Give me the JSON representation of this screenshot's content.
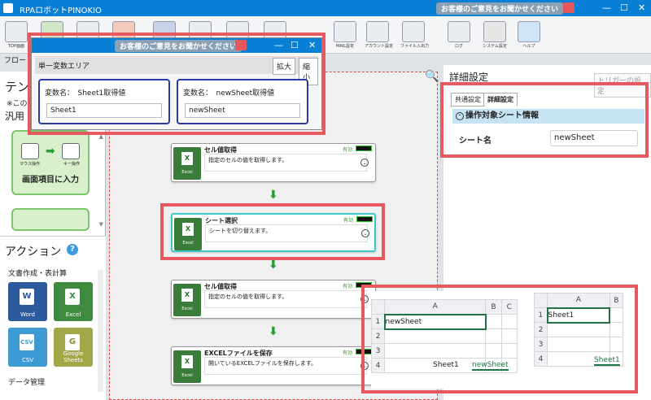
{
  "app": {
    "title": "RPAロボットPINOKIO",
    "feedback": "お客様のご意見をお聞かせください"
  },
  "ribbon": {
    "items": [
      {
        "label": "TOP画面"
      },
      {
        "label": ""
      },
      {
        "label": ""
      },
      {
        "label": ""
      },
      {
        "label": ""
      },
      {
        "label": ""
      },
      {
        "label": ""
      },
      {
        "label": ""
      },
      {
        "label": ""
      },
      {
        "label": ""
      },
      {
        "label": ""
      },
      {
        "label": "MAIL設定"
      },
      {
        "label": "アカウント設定"
      },
      {
        "label": "ファイル入出力"
      },
      {
        "label": "ログ"
      },
      {
        "label": "システム設定"
      },
      {
        "label": "ヘルプ"
      }
    ]
  },
  "flow_label": "フロー",
  "left_panel": {
    "title": "テン",
    "note": "※この",
    "general": "汎用",
    "tile1": {
      "label": "画面項目に入力",
      "mouse": "マウス操作",
      "keyboard": "キー操作"
    }
  },
  "actions": {
    "title": "アクション",
    "help": "?",
    "cat1": "文書作成・表計算",
    "cat2": "データ管理",
    "tiles": [
      {
        "label": "Word",
        "glyph": "W"
      },
      {
        "label": "Excel",
        "glyph": "X"
      },
      {
        "label": "CSV",
        "glyph": "CSV"
      },
      {
        "label": "Google Sheets",
        "glyph": "G"
      }
    ]
  },
  "cards": [
    {
      "title": "セル値取得",
      "desc": "指定のセルの値を取得します。",
      "status": "有効",
      "icon_text": "Excel"
    },
    {
      "title": "シート選択",
      "desc": "シートを切り替えます。",
      "status": "有効",
      "icon_text": "Excel"
    },
    {
      "title": "セル値取得",
      "desc": "指定のセルの値を取得します。",
      "status": "有効",
      "icon_text": "Excel"
    },
    {
      "title": "EXCELファイルを保存",
      "desc": "開いているEXCELファイルを保存します。",
      "status": "有効",
      "icon_text": "Excel"
    }
  ],
  "right_panel": {
    "title": "詳細設定",
    "trigger": "トリガーの設定",
    "tabs": [
      "共通設定",
      "詳細設定"
    ],
    "section": "操作対象シート情報",
    "field_label": "シート名",
    "field_value": "newSheet"
  },
  "popup": {
    "feedback": "お客様のご意見をお聞かせください",
    "header": "単一変数エリア",
    "expand": "拡大",
    "shrink": "縮小",
    "vars": [
      {
        "label": "変数名：　Sheet1取得値",
        "value": "Sheet1"
      },
      {
        "label": "変数名：　newSheet取得値",
        "value": "newSheet"
      }
    ]
  },
  "sheet_left": {
    "cols": [
      "A",
      "B",
      "C"
    ],
    "rows": [
      "1",
      "2",
      "3",
      "4"
    ],
    "cell_a1": "newSheet",
    "tabs": [
      "Sheet1",
      "newSheet"
    ]
  },
  "sheet_right": {
    "cols": [
      "A",
      "B"
    ],
    "rows": [
      "1",
      "2",
      "3",
      "4"
    ],
    "cell_a1": "Sheet1",
    "tab": "Sheet1"
  }
}
